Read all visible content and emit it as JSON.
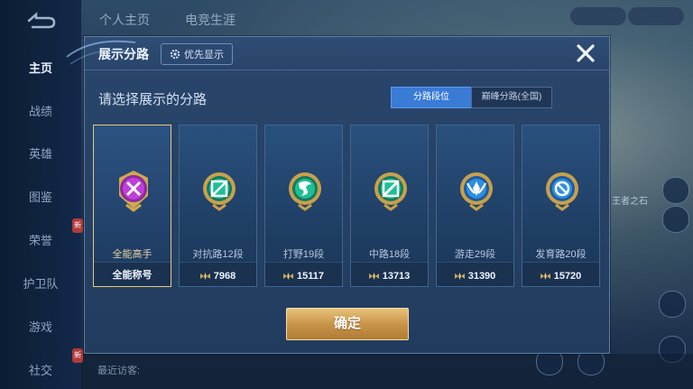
{
  "background": {
    "top_tabs": [
      "个人主页",
      "电竞生涯"
    ],
    "left_nav": [
      "主页",
      "战绩",
      "英雄",
      "图鉴",
      "荣誉",
      "护卫队",
      "游戏",
      "社交"
    ],
    "active_nav": "主页",
    "nav_badges": [
      "新",
      "新"
    ],
    "recent_visitors": "最近访客:",
    "right_side_label": "王者之石"
  },
  "dialog": {
    "title": "展示分路",
    "priority_button": "优先显示",
    "subtitle": "请选择展示的分路",
    "toggle": {
      "active": "分路段位",
      "inactive": "巅峰分路(全国)"
    },
    "confirm": "确定",
    "cards": [
      {
        "label": "全能高手",
        "value": "全能称号",
        "selected": true,
        "icon": "all-round-emblem-icon",
        "color": "#c03fd8",
        "show_wings": false
      },
      {
        "label": "对抗路12段",
        "value": "7968",
        "selected": false,
        "icon": "clash-lane-emblem-icon",
        "color": "#1fbf95",
        "show_wings": true
      },
      {
        "label": "打野19段",
        "value": "15117",
        "selected": false,
        "icon": "jungle-emblem-icon",
        "color": "#1fbf95",
        "show_wings": true
      },
      {
        "label": "中路18段",
        "value": "13713",
        "selected": false,
        "icon": "mid-lane-emblem-icon",
        "color": "#1fbf95",
        "show_wings": true
      },
      {
        "label": "游走29段",
        "value": "31390",
        "selected": false,
        "icon": "roam-emblem-icon",
        "color": "#2f8fe0",
        "show_wings": true
      },
      {
        "label": "发育路20段",
        "value": "15720",
        "selected": false,
        "icon": "farm-lane-emblem-icon",
        "color": "#2f8fe0",
        "show_wings": true
      }
    ]
  },
  "colors": {
    "accent_blue": "#3a7bd6",
    "gold": "#e6c97a",
    "dialog_bg": "#223c5f"
  }
}
